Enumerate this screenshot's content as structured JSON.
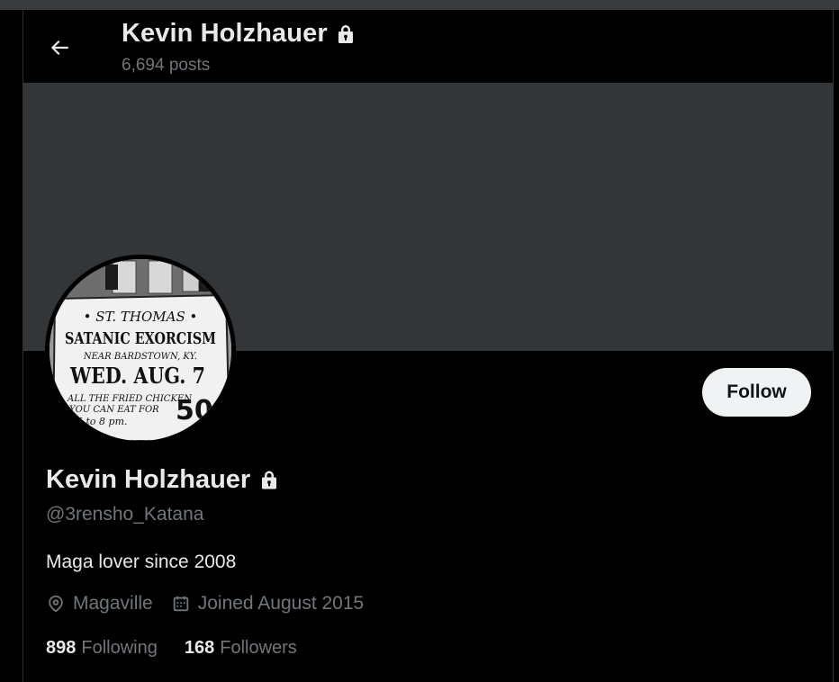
{
  "header": {
    "name": "Kevin Holzhauer",
    "posts_count": "6,694 posts"
  },
  "profile": {
    "name": "Kevin Holzhauer",
    "handle": "@3rensho_Katana",
    "bio": "Maga lover since 2008",
    "location": "Magaville",
    "joined": "Joined August 2015",
    "following_count": "898",
    "following_label": "Following",
    "followers_count": "168",
    "followers_label": "Followers"
  },
  "avatar": {
    "sign_line1": "• ST. THOMAS •",
    "sign_line2": "SATANIC EXORCISM",
    "sign_line3": "NEAR BARDSTOWN, KY.",
    "sign_line4": "WED. AUG. 7",
    "sign_line5": "ALL THE FRIED CHICKEN",
    "sign_line6": "YOU CAN EAT FOR",
    "sign_line7": "5 to 8 pm.",
    "sign_price": "50"
  },
  "actions": {
    "follow_label": "Follow"
  },
  "icons": {
    "back": "arrow-left-icon",
    "lock": "lock-icon",
    "location": "location-pin-icon",
    "calendar": "calendar-icon"
  },
  "colors": {
    "background": "#000000",
    "banner": "#333639",
    "primary_text": "#e7e9ea",
    "secondary_text": "#71767b",
    "follow_button_bg": "#eff3f4",
    "follow_button_text": "#0f1419"
  }
}
